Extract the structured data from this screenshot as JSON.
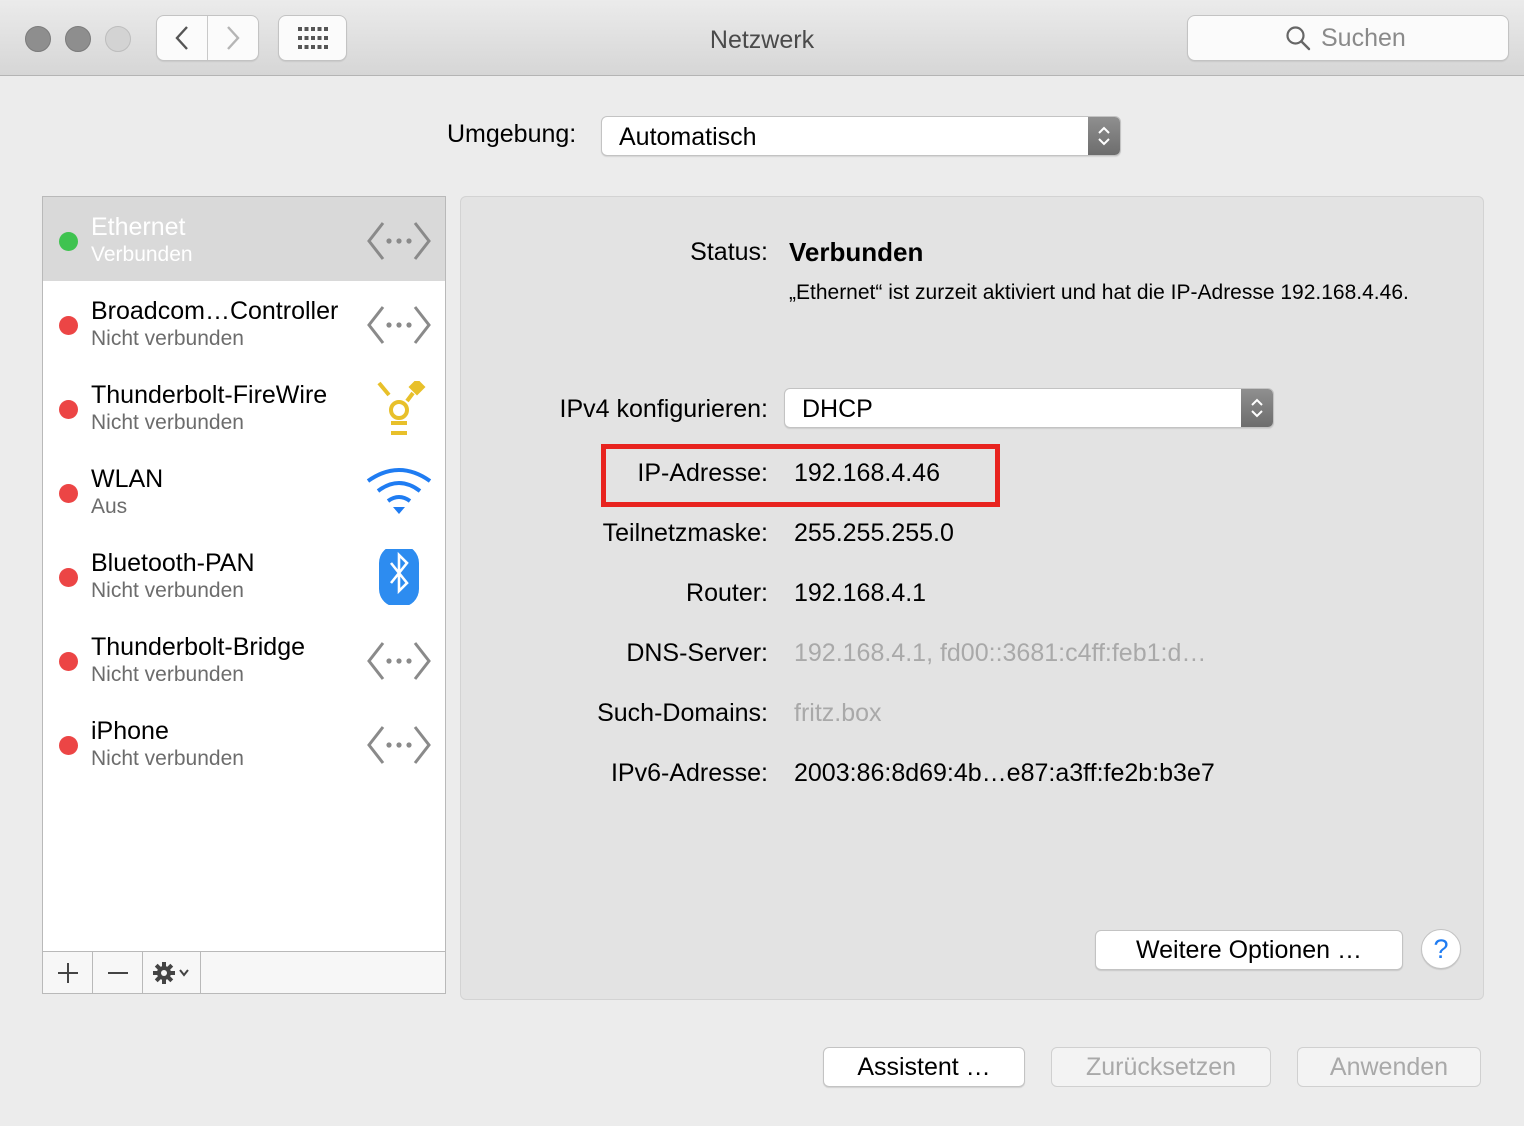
{
  "window": {
    "title": "Netzwerk",
    "search_placeholder": "Suchen"
  },
  "location": {
    "label": "Umgebung:",
    "value": "Automatisch"
  },
  "services": [
    {
      "name": "Ethernet",
      "status": "Verbunden",
      "state": "connected",
      "icon": "ethernet-icon"
    },
    {
      "name": "Broadcom…Controller",
      "status": "Nicht verbunden",
      "state": "disconnected",
      "icon": "ethernet-icon"
    },
    {
      "name": "Thunderbolt-FireWire",
      "status": "Nicht verbunden",
      "state": "disconnected",
      "icon": "firewire-icon"
    },
    {
      "name": "WLAN",
      "status": "Aus",
      "state": "disconnected",
      "icon": "wifi-icon"
    },
    {
      "name": "Bluetooth-PAN",
      "status": "Nicht verbunden",
      "state": "disconnected",
      "icon": "bluetooth-icon"
    },
    {
      "name": "Thunderbolt-Bridge",
      "status": "Nicht verbunden",
      "state": "disconnected",
      "icon": "ethernet-icon"
    },
    {
      "name": "iPhone",
      "status": "Nicht verbunden",
      "state": "disconnected",
      "icon": "ethernet-icon"
    }
  ],
  "details": {
    "status_label": "Status:",
    "status_value": "Verbunden",
    "status_description": "„Ethernet“ ist zurzeit aktiviert und hat die IP-Adresse 192.168.4.46.",
    "ipv4_label": "IPv4 konfigurieren:",
    "ipv4_value": "DHCP",
    "ip_label": "IP-Adresse:",
    "ip_value": "192.168.4.46",
    "subnet_label": "Teilnetzmaske:",
    "subnet_value": "255.255.255.0",
    "router_label": "Router:",
    "router_value": "192.168.4.1",
    "dns_label": "DNS-Server:",
    "dns_value": "192.168.4.1, fd00::3681:c4ff:feb1:d…",
    "domains_label": "Such-Domains:",
    "domains_value": "fritz.box",
    "ipv6_label": "IPv6-Adresse:",
    "ipv6_value": "2003:86:8d69:4b…e87:a3ff:fe2b:b3e7",
    "more_options": "Weitere Optionen …",
    "help": "?"
  },
  "buttons": {
    "assistant": "Assistent …",
    "reset": "Zurücksetzen",
    "apply": "Anwenden"
  },
  "colors": {
    "connected": "#3fc350",
    "disconnected": "#ec4545",
    "highlight": "#e8231f",
    "accent": "#1f7cf2"
  }
}
